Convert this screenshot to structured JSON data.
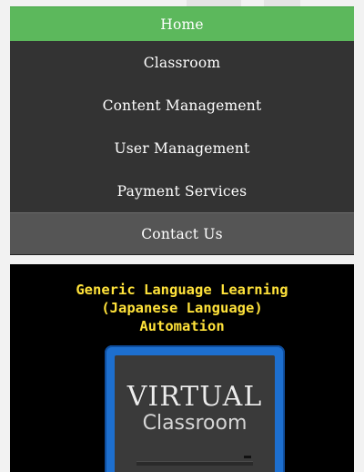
{
  "nav": {
    "items": [
      {
        "label": "Home"
      },
      {
        "label": "Classroom"
      },
      {
        "label": "Content Management"
      },
      {
        "label": "User Management"
      },
      {
        "label": "Payment Services"
      },
      {
        "label": "Contact Us"
      }
    ]
  },
  "hero": {
    "title_lines": [
      "Generic Language Learning",
      "(Japanese Language)",
      "Automation"
    ],
    "title_color": "#ffe23a",
    "logo": {
      "line1": "VIRTUAL",
      "line2": "Classroom"
    }
  },
  "colors": {
    "home_active": "#5cb85c",
    "menu_dark": "#333333",
    "menu_contact": "#555555",
    "monitor_blue": "#1d6fcf"
  }
}
